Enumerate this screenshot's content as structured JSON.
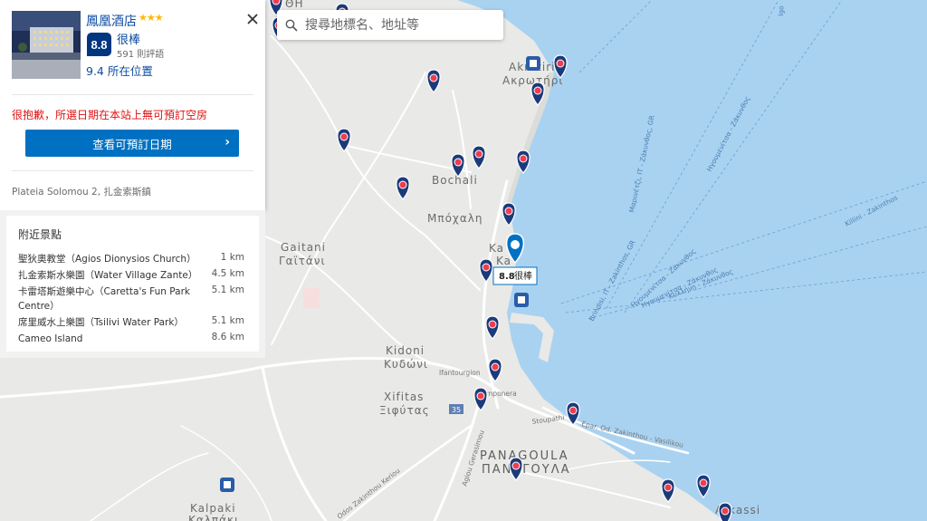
{
  "search": {
    "placeholder": "搜尋地標名、地址等"
  },
  "hotel": {
    "name": "鳳凰酒店",
    "stars": "★★★",
    "score": "8.8",
    "score_word": "很棒",
    "reviews": "591 則評語",
    "location_score": "9.4 所在位置",
    "unavailable": "很抱歉，所選日期在本站上無可預訂空房",
    "cta": "查看可預訂日期",
    "address": "Plateia Solomou 2, 扎金索斯鎮"
  },
  "nearby": {
    "title": "附近景點",
    "items": [
      {
        "name": "聖狄奧教堂（Agios Dionysios Church）",
        "dist": "1 km"
      },
      {
        "name": "扎金索斯水樂園（Water Village Zante）",
        "dist": "4.5 km"
      },
      {
        "name": "卡雷塔斯遊樂中心（Caretta's Fun Park Centre）",
        "dist": "5.1 km"
      },
      {
        "name": "席里威水上樂園（Tsilivi Water Park）",
        "dist": "5.1 km"
      },
      {
        "name": "Cameo Island",
        "dist": "8.6 km"
      }
    ]
  },
  "map": {
    "places": [
      {
        "name": "Akrotiri"
      },
      {
        "name": "Ακρωτήρι"
      },
      {
        "name": "Bochali"
      },
      {
        "name": "Μπόχαλη"
      },
      {
        "name": "Gaitani"
      },
      {
        "name": "Γαϊτάνι"
      },
      {
        "name": "Kidoni"
      },
      {
        "name": "Κυδώνι"
      },
      {
        "name": "Xifitas"
      },
      {
        "name": "Ξιφύτας"
      },
      {
        "name": "PANAGOULA"
      },
      {
        "name": "ΠΑΝΑΓΟΥΛΑ"
      },
      {
        "name": "Kalpaki"
      },
      {
        "name": "Καλπάκι"
      }
    ],
    "ferry_routes": [
      {
        "name": "Μαρινέτζι, IT - Ζάκυνθος, GR"
      },
      {
        "name": "Ηγουμενίτσα - Ζάκυνθος"
      },
      {
        "name": "Killini - Zakinthos"
      },
      {
        "name": "Ηγουμενίτσα - Ζάκυνθος"
      },
      {
        "name": "Κυλλήνη - Ζάκυνθος"
      },
      {
        "name": "Brindisi, IT - Zakinthos, GR"
      },
      {
        "name": "Ηγουμενίτσα - Ζάκυνθος"
      },
      {
        "name": "Igo"
      }
    ],
    "roads": [
      {
        "name": "Ifantourgion"
      },
      {
        "name": "mponera"
      },
      {
        "name": "35"
      },
      {
        "name": "Stoupathi"
      },
      {
        "name": "Epar. Od. Zakinthou - Vasilikou"
      },
      {
        "name": "Agiou Gerasimou"
      },
      {
        "name": "Odos Zakinthou Keriou"
      }
    ],
    "partial_labels": [
      {
        "name": "ΘΗ"
      },
      {
        "name": "Arkassi"
      },
      {
        "name": "Ka"
      },
      {
        "name": "Ka"
      }
    ],
    "main_pin_label": {
      "score": "8.8",
      "word": "很棒"
    },
    "colors": {
      "sea": "#a9d2f1",
      "land": "#e9e9e7",
      "pin": "#1b3a7a",
      "pin_dot": "#ee3d4f"
    }
  }
}
